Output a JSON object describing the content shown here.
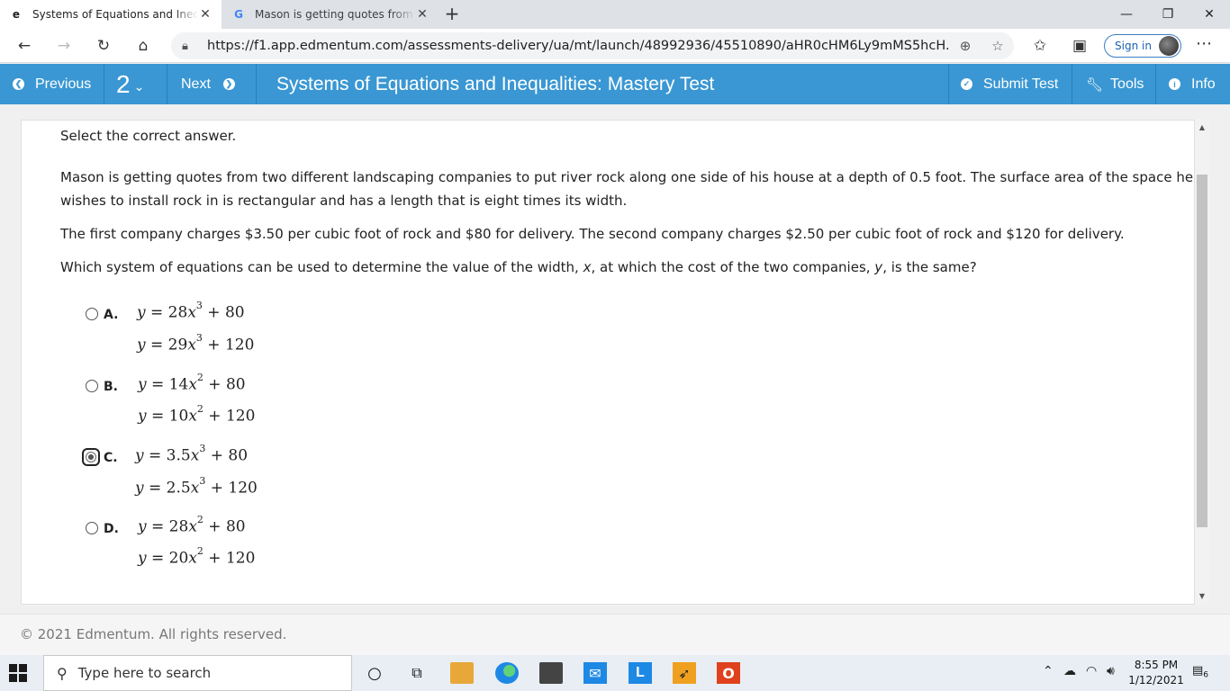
{
  "browser": {
    "tabs": [
      {
        "title": "Systems of Equations and Inequa",
        "favicon": "e"
      },
      {
        "title": "Mason is getting quotes from tw",
        "favicon": "G"
      }
    ],
    "url": "https://f1.app.edmentum.com/assessments-delivery/ua/mt/launch/48992936/45510890/aHR0cHM6Ly9mMS5hcH...",
    "signin_label": "Sign in"
  },
  "header": {
    "previous_label": "Previous",
    "question_number": "2",
    "next_label": "Next",
    "title": "Systems of Equations and Inequalities: Mastery Test",
    "submit_label": "Submit Test",
    "tools_label": "Tools",
    "info_label": "Info"
  },
  "question": {
    "instruction": "Select the correct answer.",
    "para1_line1": "Mason is getting quotes from two different landscaping companies to put river rock along one side of his house at a depth of 0.5 foot. The surface area of the space he",
    "para1_line2": "wishes to install rock in is rectangular and has a length that is eight times its width.",
    "para2": "The first company charges $3.50 per cubic foot of rock and $80 for delivery. The second company charges $2.50 per cubic foot of rock and $120 for delivery.",
    "para3_a": "Which system of equations can be used to determine the value of the width, ",
    "para3_x": "x",
    "para3_b": ", at which the cost of the two companies, ",
    "para3_y": "y",
    "para3_c": ", is the same?"
  },
  "options": [
    {
      "label": "A.",
      "eq1_coef": "28",
      "eq1_exp": "3",
      "eq1_const": "80",
      "eq2_coef": "29",
      "eq2_exp": "3",
      "eq2_const": "120",
      "selected": false
    },
    {
      "label": "B.",
      "eq1_coef": "14",
      "eq1_exp": "2",
      "eq1_const": "80",
      "eq2_coef": "10",
      "eq2_exp": "2",
      "eq2_const": "120",
      "selected": false
    },
    {
      "label": "C.",
      "eq1_coef": "3.5",
      "eq1_exp": "3",
      "eq1_const": "80",
      "eq2_coef": "2.5",
      "eq2_exp": "3",
      "eq2_const": "120",
      "selected": true
    },
    {
      "label": "D.",
      "eq1_coef": "28",
      "eq1_exp": "2",
      "eq1_const": "80",
      "eq2_coef": "20",
      "eq2_exp": "2",
      "eq2_const": "120",
      "selected": false
    }
  ],
  "footer": {
    "copyright": "© 2021 Edmentum. All rights reserved."
  },
  "taskbar": {
    "search_placeholder": "Type here to search",
    "time": "8:55 PM",
    "date": "1/12/2021",
    "notification_count": "6"
  },
  "colors": {
    "header_blue": "#3a97d3",
    "accent_link": "#1a5fb4"
  }
}
